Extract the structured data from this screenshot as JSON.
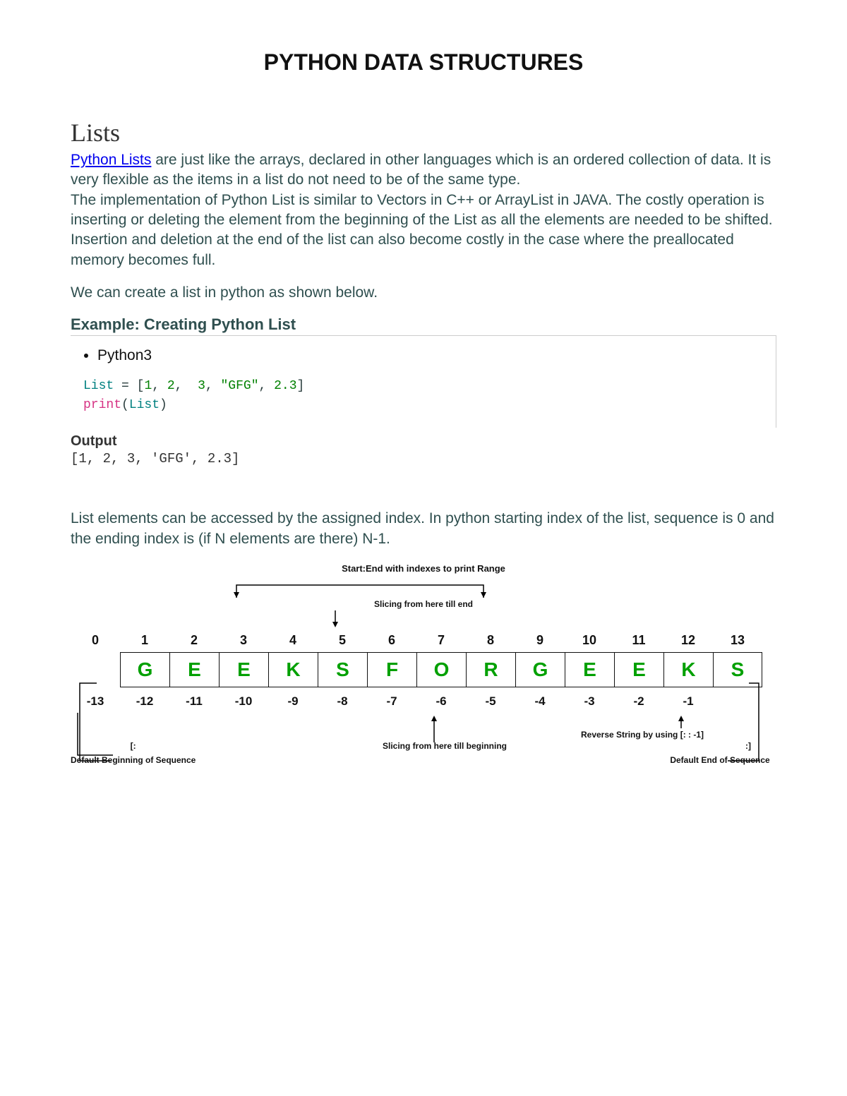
{
  "title": "PYTHON DATA STRUCTURES",
  "section_heading": "Lists",
  "link_text": "Python Lists",
  "para1_rest": " are just like the arrays, declared in other languages which is an ordered collection of data. It is very flexible as the items in a list do not need to be of the same type.",
  "para1b": "The implementation of Python List is similar to Vectors in C++ or ArrayList in JAVA. The costly operation is inserting or deleting the element from the beginning of the List as all the elements are needed to be shifted. Insertion and deletion at the end of the list can also become costly in the case where the preallocated memory becomes full.",
  "para2": "We can create a list in python as shown below.",
  "example_heading": "Example: Creating Python List",
  "lang_tab": "Python3",
  "code": {
    "list_kw": "List",
    "eq": " = [",
    "v1": "1",
    "c1": ", ",
    "v2": "2",
    "c2": ",  ",
    "v3": "3",
    "c3": ", ",
    "v4": "\"GFG\"",
    "c4": ", ",
    "v5": "2.3",
    "close": "]",
    "print_kw": "print",
    "print_open": "(",
    "print_arg": "List",
    "print_close": ")"
  },
  "output_label": "Output",
  "output_text": "[1, 2, 3, 'GFG', 2.3]",
  "para3": "List elements can be accessed by the assigned index. In python starting index of the list, sequence is 0 and the ending index is (if N elements are there) N-1.",
  "diagram": {
    "top_caption": "Start:End with indexes to print Range",
    "sub_caption": "Slicing from here till end",
    "pos_indices": [
      "0",
      "1",
      "2",
      "3",
      "4",
      "5",
      "6",
      "7",
      "8",
      "9",
      "10",
      "11",
      "12",
      "13"
    ],
    "letters_row": [
      "",
      "G",
      "E",
      "E",
      "K",
      "S",
      "F",
      "O",
      "R",
      "G",
      "E",
      "E",
      "K",
      "S"
    ],
    "neg_indices": [
      "-13",
      "-12",
      "-11",
      "-10",
      "-9",
      "-8",
      "-7",
      "-6",
      "-5",
      "-4",
      "-3",
      "-2",
      "-1",
      ""
    ],
    "left_bracket": "[:",
    "left_label": "Default Beginning of Sequence",
    "mid_label": "Slicing from here till beginning",
    "rev_label": "Reverse String by using [: : -1]",
    "right_bracket": ":]",
    "right_label": "Default End of Sequence"
  }
}
